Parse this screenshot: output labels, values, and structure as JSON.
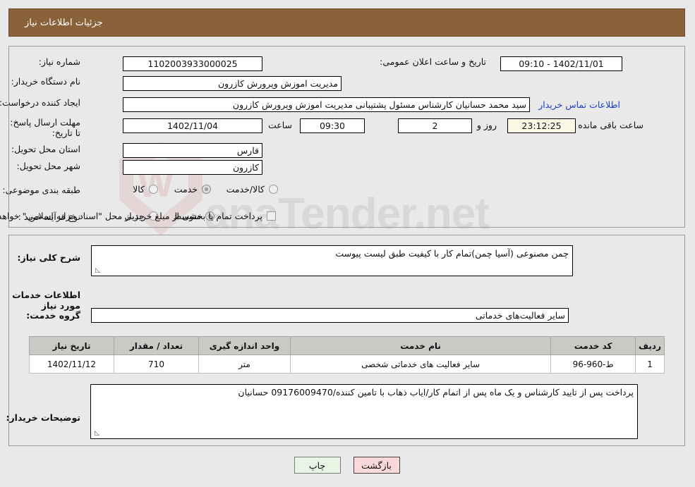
{
  "header": {
    "title": "جزئیات اطلاعات نیاز"
  },
  "form": {
    "need_number_label": "شماره نیاز:",
    "need_number_value": "1102003933000025",
    "announce_label": "تاریخ و ساعت اعلان عمومی:",
    "announce_value": "1402/11/01 - 09:10",
    "buyer_org_label": "نام دستگاه خریدار:",
    "buyer_org_value": "مدیریت اموزش وپرورش کازرون",
    "creator_label": "ایجاد کننده درخواست:",
    "creator_value": "سید محمد  حسانیان  کارشناس مسئول پشتیبانی مدیریت اموزش وپرورش کازرون",
    "contact_link": "اطلاعات تماس خریدار",
    "deadline_label": "مهلت ارسال پاسخ: تا تاریخ:",
    "deadline_date": "1402/11/04",
    "hour_label": "ساعت",
    "deadline_time": "09:30",
    "days_value": "2",
    "days_label": "روز و",
    "countdown_value": "23:12:25",
    "remaining_label": "ساعت باقی مانده",
    "province_label": "استان محل تحویل:",
    "province_value": "فارس",
    "city_label": "شهر محل تحویل:",
    "city_value": "کازرون",
    "category_label": "طبقه بندی موضوعی:",
    "category_options": [
      {
        "label": "کالا",
        "selected": false
      },
      {
        "label": "خدمت",
        "selected": true
      },
      {
        "label": "کالا/خدمت",
        "selected": false
      }
    ],
    "process_label": "نوع فرآیند خرید :",
    "process_options": [
      {
        "label": "جزیی",
        "selected": false
      },
      {
        "label": "متوسط",
        "selected": true
      }
    ],
    "treasury_checkbox_label": "پرداخت تمام یا بخشی از مبلغ خرید،از محل \"اسناد خزانه اسلامی\" خواهد بود.",
    "treasury_checked": false
  },
  "details": {
    "need_desc_label": "شرح کلی نیاز:",
    "need_desc_value": "چمن مصنوعی (آسیا چمن)تمام کار با کیفیت طبق لیست پیوست",
    "services_section_title": "اطلاعات خدمات مورد نیاز",
    "service_group_label": "گروه خدمت:",
    "service_group_value": "سایر فعالیت‌های خدماتی",
    "buyer_notes_label": "توضیحات خریدار:",
    "buyer_notes_value": "پرداخت  پس از تایید کارشناس و یک ماه پس از اتمام کار/ایاب ذهاب با تامین کننده/09176009470 حسانیان"
  },
  "table": {
    "columns": [
      "ردیف",
      "کد خدمت",
      "نام خدمت",
      "واحد اندازه گیری",
      "تعداد / مقدار",
      "تاریخ نیاز"
    ],
    "rows": [
      {
        "index": "1",
        "service_code": "ط-960-96",
        "service_name": "سایر فعالیت های خدماتی شخصی",
        "unit": "متر",
        "quantity": "710",
        "need_date": "1402/11/12"
      }
    ]
  },
  "buttons": {
    "print": "چاپ",
    "back": "بازگشت"
  },
  "watermark": {
    "text": "anaTender.net"
  },
  "colors": {
    "header_bar": "#8a6239",
    "link": "#1a3fd0",
    "print_button": "#e7f5e3",
    "back_button": "#fbd9d9",
    "countdown_field": "#fbf8e3",
    "table_header": "#cbc9c6"
  }
}
